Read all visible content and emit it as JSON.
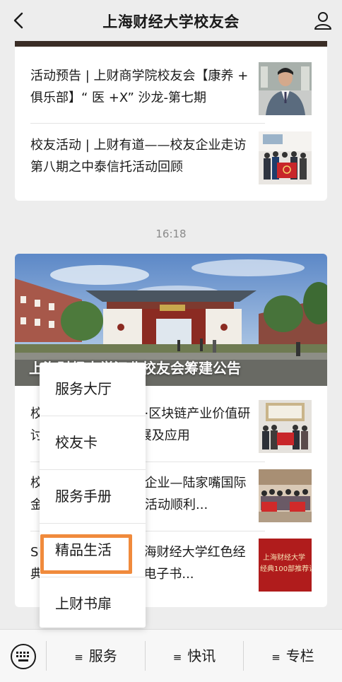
{
  "header": {
    "title": "上海财经大学校友会"
  },
  "time": "16:18",
  "card1": {
    "items": [
      {
        "text": "活动预告 | 上财商学院校友会【康养 + 俱乐部】“ 医 +X” 沙龙-第七期"
      },
      {
        "text": "校友活动 | 上财有道——校友企业走访第八期之中泰信托活动回顾"
      }
    ]
  },
  "card2": {
    "hero_title": "上海财经大学江北校友会筹建公告",
    "items": [
      {
        "text": "校友活动 | 上财讲堂·区块链产业价值研讨会暨2019年新发展及应用"
      },
      {
        "text": "校友活动 | 走进校友企业—陆家嘴国际金融资产交易所走访活动顺利..."
      },
      {
        "text": "SUFE Reading | 上海财经大学红色经典100部推荐读物》电子书..."
      }
    ],
    "thumb3_lines": [
      "上海财经大学",
      "经典100部推荐读"
    ]
  },
  "popup": {
    "items": [
      "服务大厅",
      "校友卡",
      "服务手册",
      "精品生活",
      "上财书扉"
    ]
  },
  "bottom_menu": [
    {
      "icon": "≡",
      "label": "服务"
    },
    {
      "icon": "≡",
      "label": "快讯"
    },
    {
      "icon": "≡",
      "label": "专栏"
    }
  ]
}
